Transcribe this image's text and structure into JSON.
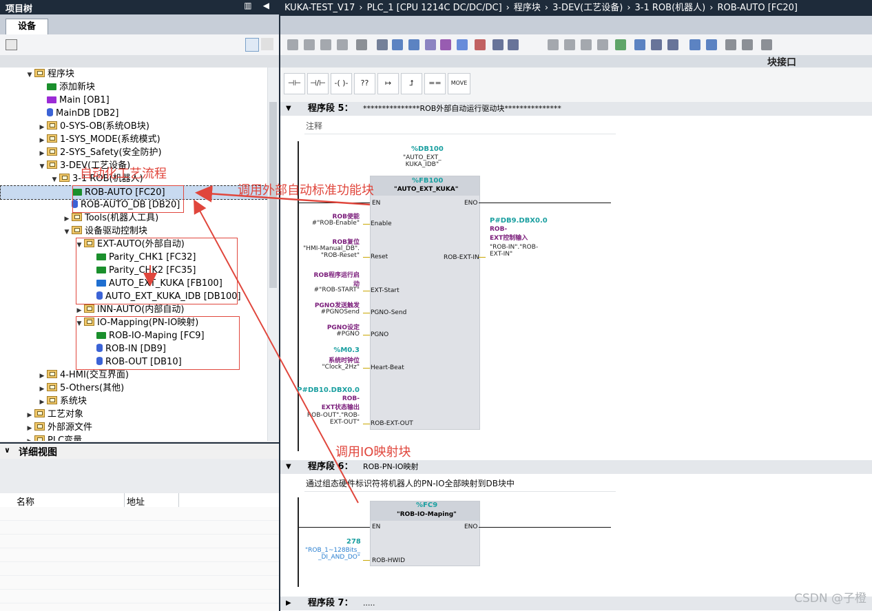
{
  "left": {
    "title": "项目树",
    "tab": "设备",
    "tree": [
      {
        "label": "程序块",
        "icon": "folder-icon",
        "depth": 3,
        "arrow": "▼"
      },
      {
        "label": "添加新块",
        "icon": "add-block-icon",
        "depth": 4,
        "arrow": ""
      },
      {
        "label": "Main [OB1]",
        "icon": "ob-icon",
        "depth": 4,
        "arrow": ""
      },
      {
        "label": "MainDB [DB2]",
        "icon": "db-icon",
        "depth": 4,
        "arrow": ""
      },
      {
        "label": "0-SYS-OB(系统OB块)",
        "icon": "folder-icon",
        "depth": 4,
        "arrow": "▶"
      },
      {
        "label": "1-SYS_MODE(系统模式)",
        "icon": "folder-icon",
        "depth": 4,
        "arrow": "▶"
      },
      {
        "label": "2-SYS_Safety(安全防护)",
        "icon": "folder-icon",
        "depth": 4,
        "arrow": "▶"
      },
      {
        "label": "3-DEV(工艺设备)",
        "icon": "folder-icon",
        "depth": 4,
        "arrow": "▼"
      },
      {
        "label": "3-1 ROB(机器人)",
        "icon": "folder-icon",
        "depth": 5,
        "arrow": "▼"
      },
      {
        "label": "ROB-AUTO [FC20]",
        "icon": "fc-icon",
        "depth": 6,
        "arrow": "",
        "selected": true
      },
      {
        "label": "ROB-AUTO_DB [DB20]",
        "icon": "db-icon",
        "depth": 6,
        "arrow": ""
      },
      {
        "label": "Tools(机器人工具)",
        "icon": "folder-icon",
        "depth": 6,
        "arrow": "▶"
      },
      {
        "label": "设备驱动控制块",
        "icon": "folder-icon",
        "depth": 6,
        "arrow": "▼"
      },
      {
        "label": "EXT-AUTO(外部自动)",
        "icon": "folder-icon",
        "depth": 7,
        "arrow": "▼"
      },
      {
        "label": "Parity_CHK1 [FC32]",
        "icon": "fc-icon",
        "depth": 8,
        "arrow": ""
      },
      {
        "label": "Parity_CHK2 [FC35]",
        "icon": "fc-icon",
        "depth": 8,
        "arrow": ""
      },
      {
        "label": "AUTO_EXT_KUKA [FB100]",
        "icon": "fb-icon",
        "depth": 8,
        "arrow": ""
      },
      {
        "label": "AUTO_EXT_KUKA_IDB [DB100]",
        "icon": "db-icon",
        "depth": 8,
        "arrow": ""
      },
      {
        "label": "INN-AUTO(内部自动)",
        "icon": "folder-icon",
        "depth": 7,
        "arrow": "▶"
      },
      {
        "label": "IO-Mapping(PN-IO映射)",
        "icon": "folder-icon",
        "depth": 7,
        "arrow": "▼"
      },
      {
        "label": "ROB-IO-Maping [FC9]",
        "icon": "fc-icon",
        "depth": 8,
        "arrow": ""
      },
      {
        "label": "ROB-IN [DB9]",
        "icon": "db-icon",
        "depth": 8,
        "arrow": ""
      },
      {
        "label": "ROB-OUT [DB10]",
        "icon": "db-icon",
        "depth": 8,
        "arrow": ""
      },
      {
        "label": "4-HMI(交互界面)",
        "icon": "folder-icon",
        "depth": 4,
        "arrow": "▶"
      },
      {
        "label": "5-Others(其他)",
        "icon": "folder-icon",
        "depth": 4,
        "arrow": "▶"
      },
      {
        "label": "系统块",
        "icon": "folder-icon",
        "depth": 4,
        "arrow": "▶"
      },
      {
        "label": "工艺对象",
        "icon": "folder-icon",
        "depth": 3,
        "arrow": "▶"
      },
      {
        "label": "外部源文件",
        "icon": "folder-icon",
        "depth": 3,
        "arrow": "▶"
      },
      {
        "label": "PLC变量",
        "icon": "folder-icon",
        "depth": 3,
        "arrow": "▶"
      }
    ],
    "detail": {
      "title": "详细视图",
      "col_name": "名称",
      "col_addr": "地址"
    }
  },
  "crumb": [
    "KUKA-TEST_V17",
    "PLC_1 [CPU 1214C DC/DC/DC]",
    "程序块",
    "3-DEV(工艺设备)",
    "3-1 ROB(机器人)",
    "ROB-AUTO [FC20]"
  ],
  "crumb_sep": "›",
  "iface": "块接口",
  "ladder": [
    "⊣⊢",
    "⊣/⊢",
    "-( )-",
    "??",
    "↦",
    "⮥",
    "==",
    "MOVE"
  ],
  "net5": {
    "head": "程序段 5：",
    "title": "***************ROB外部自动运行驱动块***************",
    "comment": "注释",
    "inst_addr": "%DB100",
    "inst_name": "\"AUTO_EXT_\nKUKA_IDB\"",
    "fb_addr": "%FB100",
    "fb_name": "\"AUTO_EXT_KUKA\"",
    "en": "EN",
    "eno": "ENO",
    "inputs": [
      {
        "pin": "Enable",
        "title": "ROB使能",
        "addr": "",
        "tag": "#\"ROB-Enable\""
      },
      {
        "pin": "Reset",
        "title": "ROB复位",
        "addr": "",
        "tag": "\"HMI-Manual_DB\".\n\"ROB-Reset\""
      },
      {
        "pin": "EXT-Start",
        "title": "ROB程序运行启\n动",
        "addr": "",
        "tag": "#\"ROB-START\""
      },
      {
        "pin": "PGNO-Send",
        "title": "PGNO发送触发",
        "addr": "",
        "tag": "#PGNOSend"
      },
      {
        "pin": "PGNO",
        "title": "PGNO设定",
        "addr": "",
        "tag": "#PGNO"
      },
      {
        "pin": "Heart-Beat",
        "title": "系统时钟位",
        "addr": "%M0.3",
        "tag": "\"Clock_2Hz\""
      },
      {
        "pin": "ROB-EXT-OUT",
        "title": "ROB-\nEXT状态输出",
        "addr": "P#DB10.DBX0.0",
        "tag": "ROB-OUT\".\"ROB-\nEXT-OUT\""
      }
    ],
    "output": {
      "pin": "ROB-EXT-IN",
      "addr": "P#DB9.DBX0.0",
      "title": "ROB-\nEXT控制输入",
      "tag": "\"ROB-IN\".\"ROB-\nEXT-IN\""
    }
  },
  "net6": {
    "head": "程序段 6：",
    "title": "ROB-PN-IO映射",
    "comment": "通过组态硬件标识符将机器人的PN-IO全部映射到DB块中",
    "fc_addr": "%FC9",
    "fc_name": "\"ROB-IO-Maping\"",
    "en": "EN",
    "eno": "ENO",
    "input": {
      "pin": "ROB-HWID",
      "value": "278",
      "tag": "\"ROB_1~128Bits_\n_DI_AND_DO\""
    }
  },
  "net7": {
    "head": "程序段 7：",
    "title": "....."
  },
  "annotations": [
    "自动化工艺流程",
    "调用外部自动标准功能块",
    "调用IO映射块"
  ],
  "watermark": "CSDN @子橙",
  "colors": {
    "accent": "#1e2b3a",
    "annotation": "#e0463c",
    "teal": "#1a9fa0",
    "purple": "#7a1c7a"
  }
}
